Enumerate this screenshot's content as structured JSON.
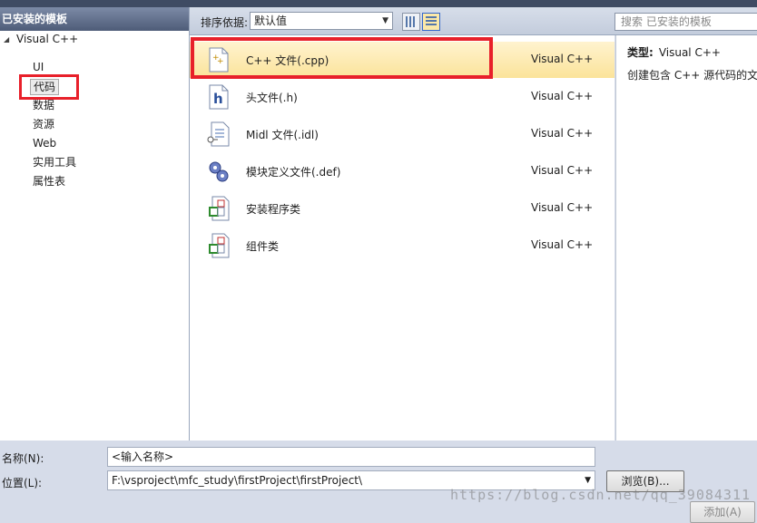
{
  "left": {
    "header": "已安装的模板",
    "root": "Visual C++",
    "items": [
      "UI",
      "代码",
      "数据",
      "资源",
      "Web",
      "实用工具",
      "属性表"
    ]
  },
  "toolbar": {
    "sort_label": "排序依据:",
    "sort_value": "默认值",
    "search_placeholder": "搜索 已安装的模板"
  },
  "templates": [
    {
      "name": "C++ 文件(.cpp)",
      "lang": "Visual C++",
      "icon": "cpp-file-icon"
    },
    {
      "name": "头文件(.h)",
      "lang": "Visual C++",
      "icon": "header-file-icon"
    },
    {
      "name": "Midl 文件(.idl)",
      "lang": "Visual C++",
      "icon": "midl-file-icon"
    },
    {
      "name": "模块定义文件(.def)",
      "lang": "Visual C++",
      "icon": "module-def-icon"
    },
    {
      "name": "安装程序类",
      "lang": "Visual C++",
      "icon": "installer-class-icon"
    },
    {
      "name": "组件类",
      "lang": "Visual C++",
      "icon": "component-class-icon"
    }
  ],
  "description": {
    "type_label": "类型:",
    "type_value": "Visual C++",
    "text": "创建包含 C++ 源代码的文"
  },
  "form": {
    "name_label": "名称(N):",
    "name_value": "<输入名称>",
    "location_label": "位置(L):",
    "location_value": "F:\\vsproject\\mfc_study\\firstProject\\firstProject\\",
    "browse_label": "浏览(B)...",
    "add_label": "添加(A)"
  },
  "watermark": "https://blog.csdn.net/qq_39084311"
}
